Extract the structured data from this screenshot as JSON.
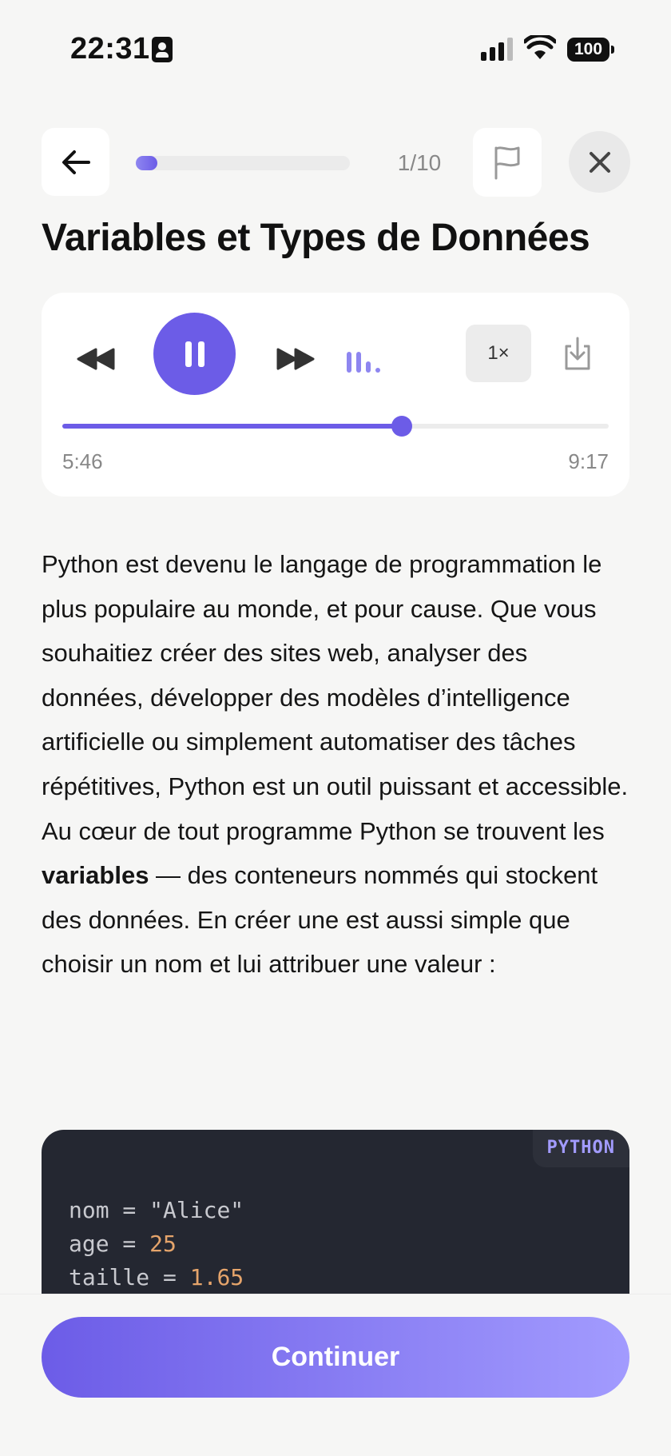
{
  "status_bar": {
    "time": "22:31",
    "battery": "100",
    "icons": [
      "contact-card-icon",
      "signal-icon",
      "wifi-icon",
      "battery-icon"
    ]
  },
  "nav": {
    "back_icon": "arrow-left-icon",
    "progress": {
      "current": 1,
      "total": 10,
      "fraction": 0.1,
      "label": "1/10"
    },
    "flag_icon": "flag-icon",
    "close_icon": "close-icon"
  },
  "title": "Variables et Types de Données",
  "player": {
    "rewind_icon": "rewind-icon",
    "pause_icon": "pause-icon",
    "forward_icon": "fast-forward-icon",
    "waveform_icon": "waveform-icon",
    "speed_label": "1×",
    "download_icon": "download-icon",
    "current_time": "5:46",
    "total_time": "9:17",
    "position_fraction": 0.622
  },
  "lesson": {
    "paragraph_before": "Python est devenu le langage de programmation le plus populaire au monde, et pour cause. Que vous souhaitiez créer des sites web, analyser des données, développer des modèles d’intelligence artificielle ou simplement automatiser des tâches répétitives, Python est un outil puissant et accessible. Au cœur de tout programme Python se trouvent les ",
    "bold_term": "variables",
    "paragraph_after": " — des conteneurs nommés qui stockent des données. En créer une est aussi simple que choisir un nom et lui attribuer une valeur :"
  },
  "code": {
    "language": "PYTHON",
    "lines": [
      {
        "name": "nom",
        "op": " = ",
        "value": "\"Alice\"",
        "type": "string"
      },
      {
        "name": "age",
        "op": " = ",
        "value": "25",
        "type": "number"
      },
      {
        "name": "taille",
        "op": " = ",
        "value": "1.65",
        "type": "number"
      }
    ]
  },
  "footer": {
    "continue_label": "Continuer"
  },
  "colors": {
    "accent": "#6c5ce7",
    "accent_light": "#a29bfe",
    "background": "#f6f6f5",
    "code_background": "#242731",
    "code_number": "#e5a46b"
  }
}
